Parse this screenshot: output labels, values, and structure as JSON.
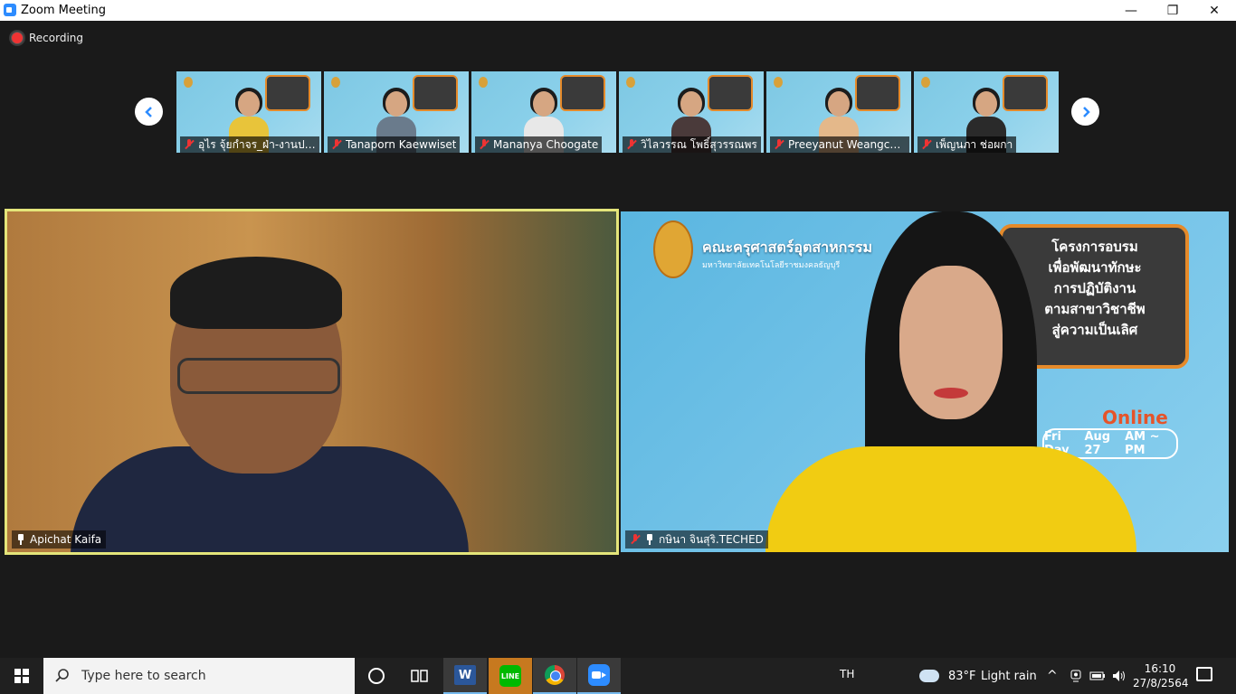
{
  "window": {
    "title": "Zoom Meeting",
    "minimize": "—",
    "maximize": "❐",
    "close": "✕"
  },
  "recording": {
    "label": "Recording"
  },
  "gallery": {
    "participants": [
      {
        "name": "อุไร จุ้ยกำจร_ฝ่า-งานประ...",
        "muted": true
      },
      {
        "name": "Tanaporn Kaewwiset",
        "muted": true
      },
      {
        "name": "Mananya Choogate",
        "muted": true
      },
      {
        "name": "วิไลวรรณ โพธิ์สุวรรณพร",
        "muted": true
      },
      {
        "name": "Preeyanut Weangcha...",
        "muted": true
      },
      {
        "name": "เพ็ญนภา ช่อผกา",
        "muted": true
      }
    ]
  },
  "main": {
    "left_video": {
      "name": "Apichat Kaifa",
      "active_speaker": true
    },
    "right_video": {
      "name": "กษินา จินสุริ.TECHED",
      "banner_title": "คณะครุศาสตร์อุตสาหกรรม",
      "banner_subtitle": "มหาวิทยาลัยเทคโนโลยีราชมงคลธัญบุรี",
      "speech_lines": [
        "โครงการอบรม",
        "เพื่อพัฒนาทักษะ",
        "การปฏิบัติงาน",
        "ตามสาขาวิชาชีพ",
        "สู่ความเป็นเลิศ"
      ],
      "online_label": "Online",
      "date_parts": [
        "Fri Day",
        "Aug 27",
        "AM ~ PM"
      ]
    }
  },
  "taskbar": {
    "search_placeholder": "Type here to search",
    "apps": [
      "task-view",
      "word",
      "line",
      "chrome",
      "zoom"
    ],
    "line_label": "LINE",
    "word_label": "W",
    "language": "TH",
    "weather_temp": "83°F",
    "weather_desc": "Light rain",
    "time": "16:10",
    "date": "27/8/2564"
  },
  "colors": {
    "active_speaker_border": "#e4e57a",
    "muted_red": "#e33",
    "zoom_blue": "#2d8cff"
  }
}
